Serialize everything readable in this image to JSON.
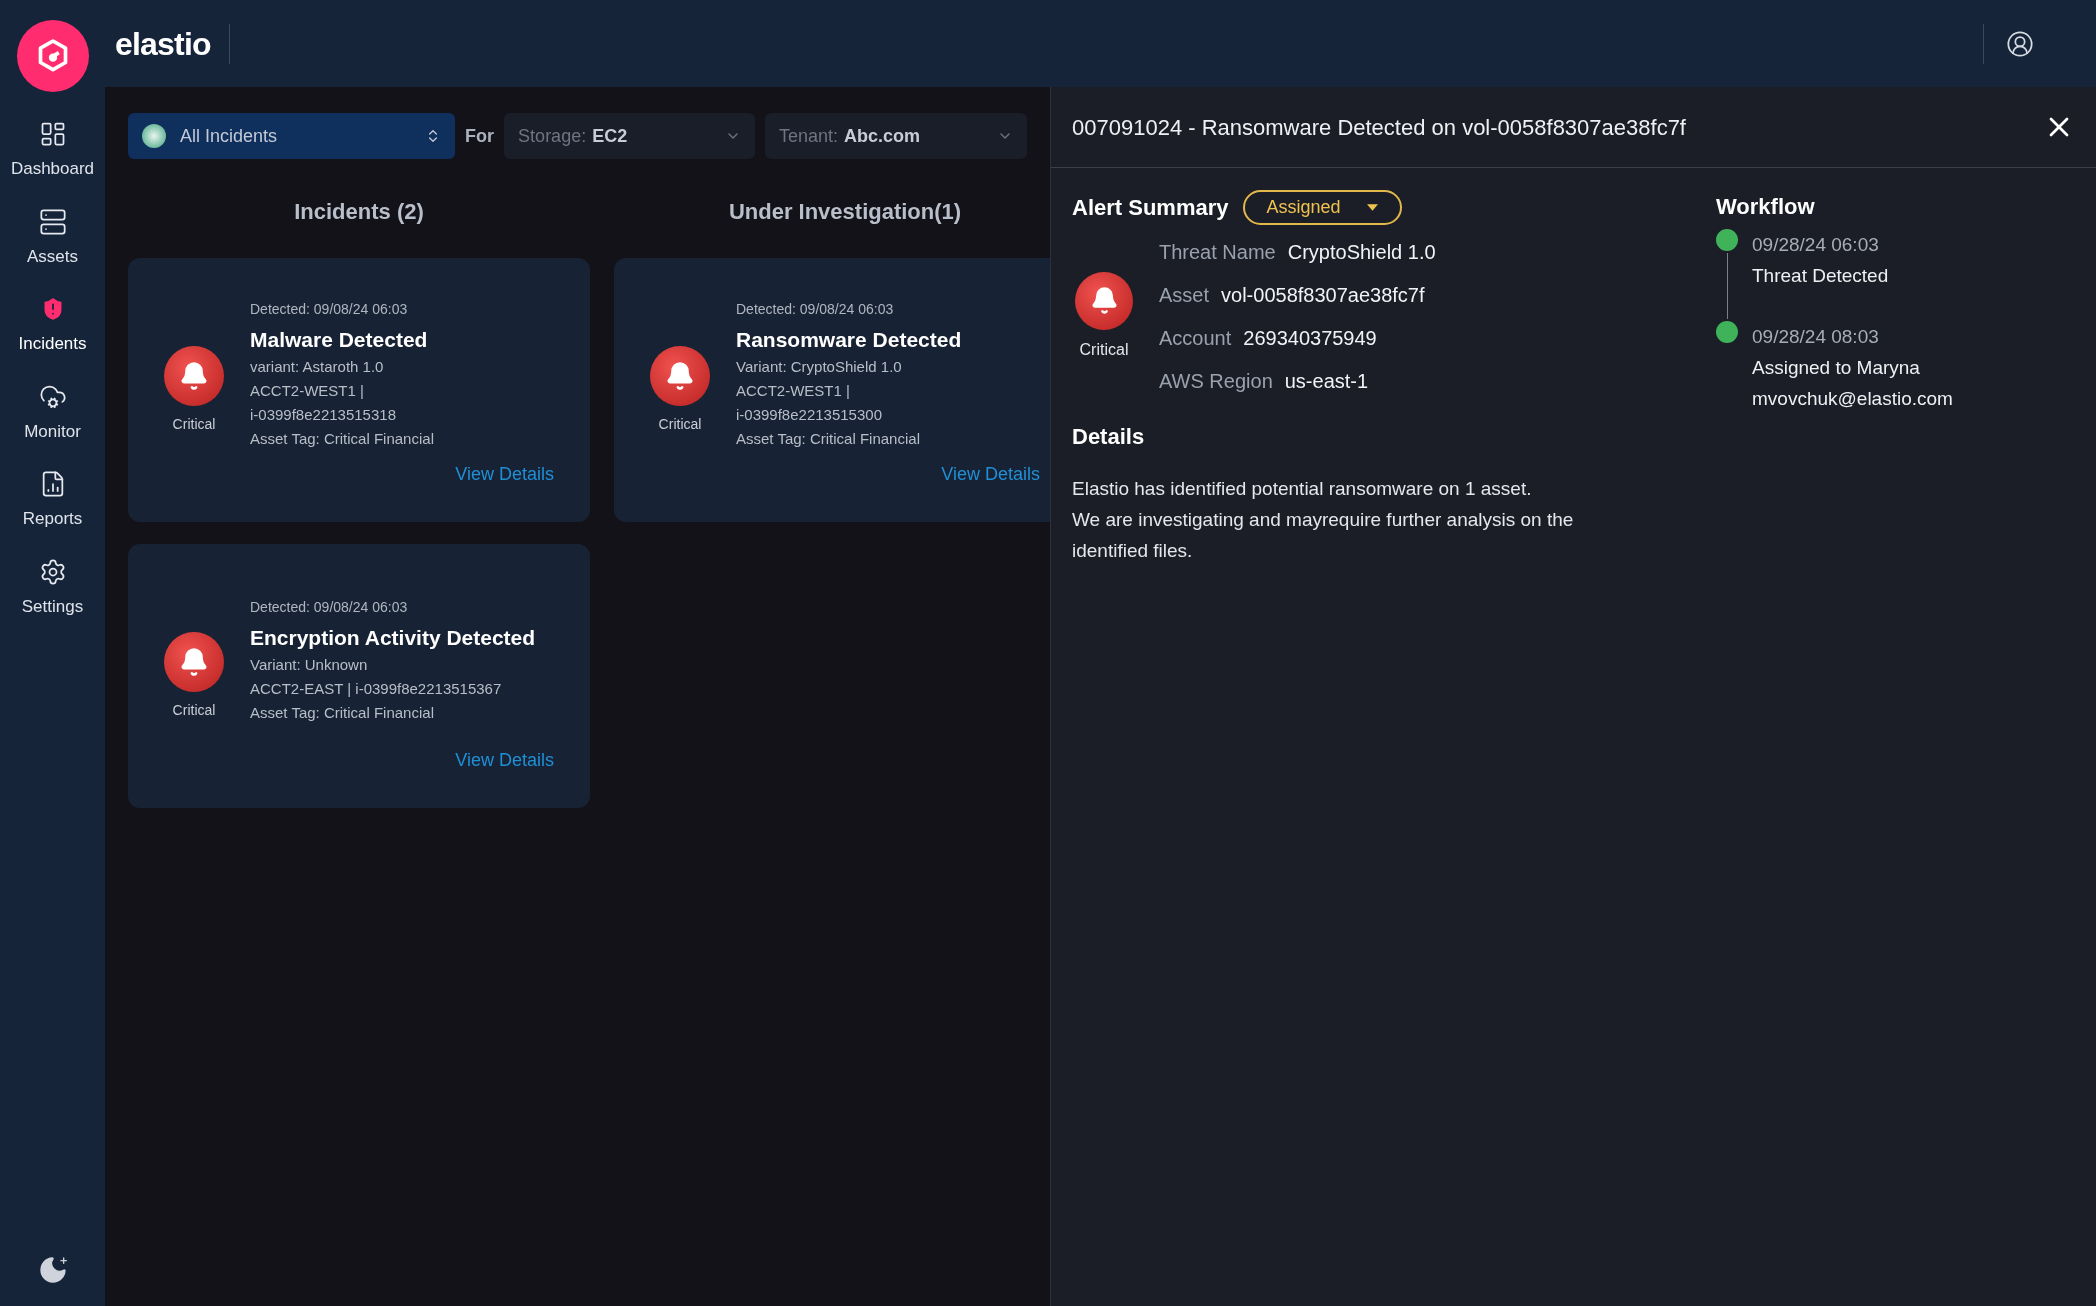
{
  "brand": {
    "name": "elastio"
  },
  "sidebar": {
    "items": [
      {
        "kind": "dashboard",
        "label": "Dashboard",
        "selected": false
      },
      {
        "kind": "assets",
        "label": "Assets",
        "selected": false
      },
      {
        "kind": "incidents",
        "label": "Incidents",
        "selected": true
      },
      {
        "kind": "monitor",
        "label": "Monitor",
        "selected": false
      },
      {
        "kind": "reports",
        "label": "Reports",
        "selected": false
      },
      {
        "kind": "settings",
        "label": "Settings",
        "selected": false
      }
    ]
  },
  "filters": {
    "scope": "All Incidents",
    "for_label": "For",
    "storage": {
      "label": "Storage:",
      "value": "EC2"
    },
    "tenant": {
      "label": "Tenant:",
      "value": "Abc.com"
    }
  },
  "columns": [
    {
      "title": "Incidents (2)",
      "cards": [
        {
          "detected": "Detected: 09/08/24 06:03",
          "title": "Malware Detected",
          "severity": "Critical",
          "lines": [
            "variant: Astaroth 1.0",
            "ACCT2-WEST1 |",
            "i-0399f8e2213515318",
            "Asset Tag: Critical Financial"
          ],
          "link": "View Details"
        },
        {
          "detected": "Detected: 09/08/24 06:03",
          "title": "Encryption Activity Detected",
          "severity": "Critical",
          "lines": [
            "Variant: Unknown",
            "ACCT2-EAST | i-0399f8e2213515367",
            "Asset Tag: Critical Financial"
          ],
          "link": "View Details"
        }
      ]
    },
    {
      "title": "Under Investigation(1)",
      "cards": [
        {
          "detected": "Detected: 09/08/24 06:03",
          "title": "Ransomware Detected",
          "severity": "Critical",
          "lines": [
            "Variant: CryptoShield 1.0",
            "ACCT2-WEST1 |",
            "i-0399f8e2213515300",
            "Asset Tag: Critical Financial"
          ],
          "link": "View Details"
        }
      ]
    }
  ],
  "panel": {
    "title": "007091024 - Ransomware Detected on vol-0058f8307ae38fc7f",
    "summary_heading": "Alert Summary",
    "status": "Assigned",
    "severity": "Critical",
    "fields": [
      {
        "label": "Threat Name",
        "value": "CryptoShield 1.0"
      },
      {
        "label": "Asset",
        "value": "vol-0058f8307ae38fc7f"
      },
      {
        "label": "Account",
        "value": "269340375949"
      },
      {
        "label": "AWS Region",
        "value": "us-east-1"
      }
    ],
    "details_heading": "Details",
    "details": [
      "Elastio has identified potential ransomware on 1 asset.",
      "We are investigating and mayrequire further analysis on the identified files."
    ],
    "workflow_heading": "Workflow",
    "workflow": [
      {
        "time": "09/28/24 06:03",
        "lines": [
          "Threat Detected"
        ]
      },
      {
        "time": "09/28/24 08:03",
        "lines": [
          "Assigned to Maryna",
          "mvovchuk@elastio.com"
        ]
      }
    ]
  }
}
